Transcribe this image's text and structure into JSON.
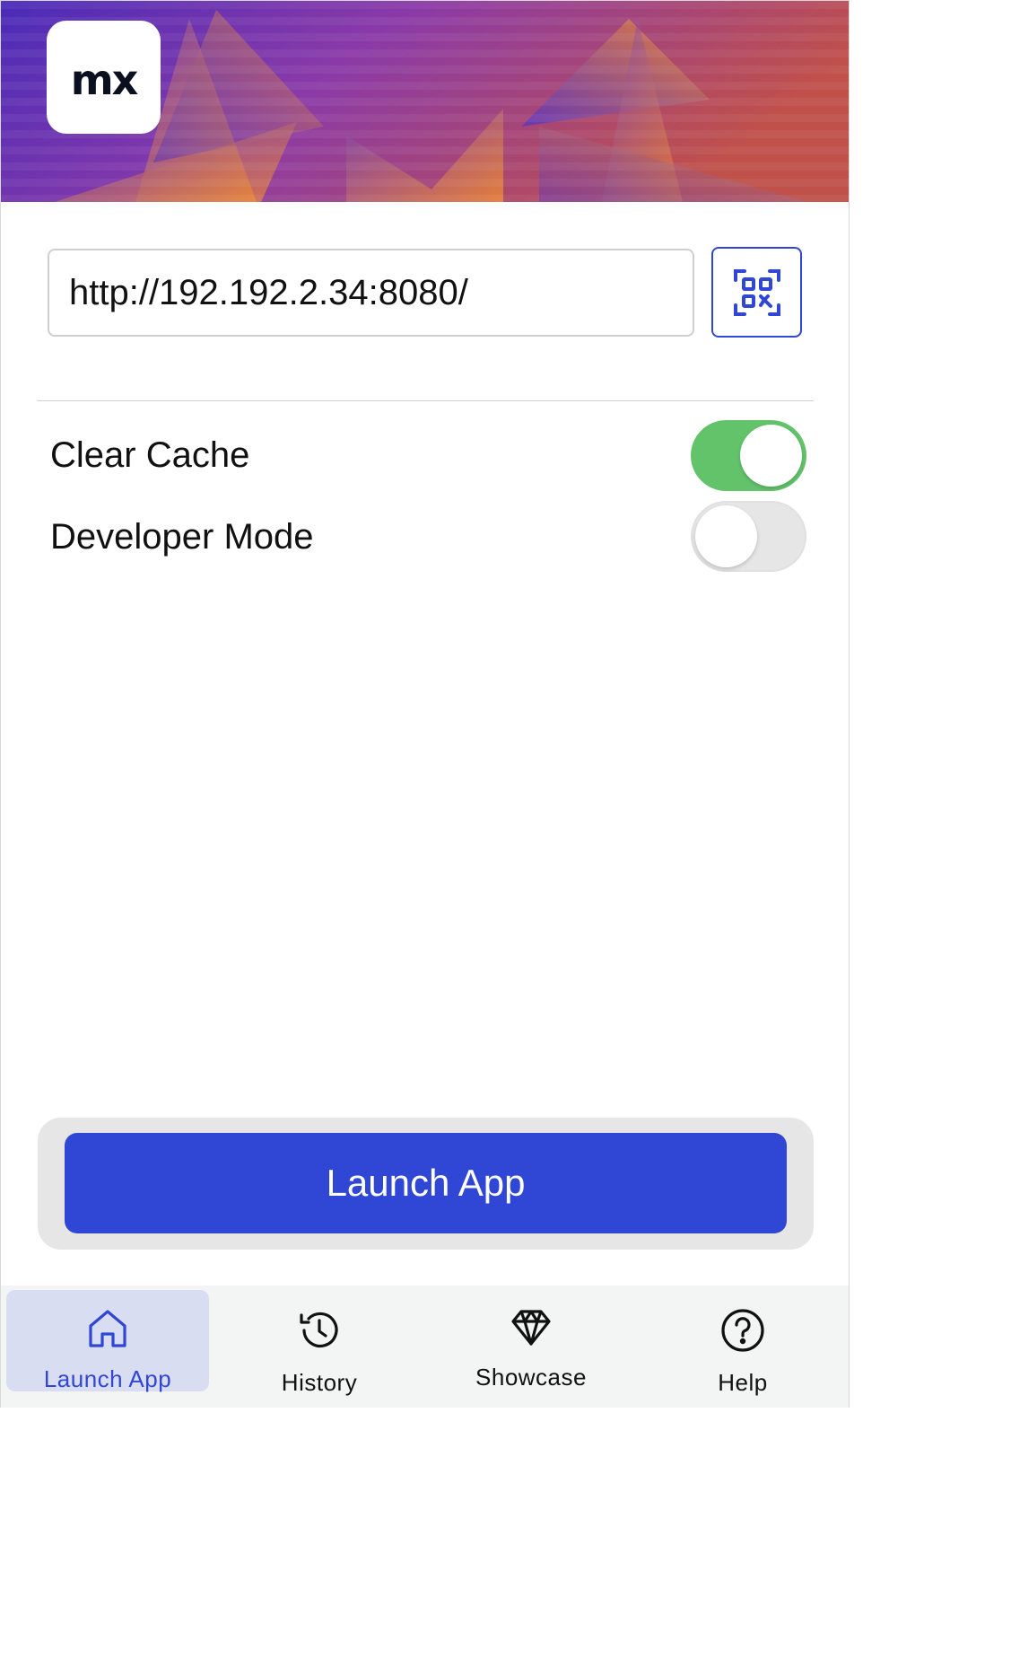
{
  "header": {
    "logo_text": "mx"
  },
  "url_input": {
    "value": "http://192.192.2.34:8080/",
    "scan_icon": "qr-code-icon"
  },
  "settings": {
    "clear_cache": {
      "label": "Clear Cache",
      "enabled": true
    },
    "developer_mode": {
      "label": "Developer Mode",
      "enabled": false
    }
  },
  "launch": {
    "label": "Launch App"
  },
  "tabs": [
    {
      "label": "Launch App",
      "icon": "home-icon",
      "active": true
    },
    {
      "label": "History",
      "icon": "history-icon",
      "active": false
    },
    {
      "label": "Showcase",
      "icon": "diamond-icon",
      "active": false
    },
    {
      "label": "Help",
      "icon": "help-icon",
      "active": false
    }
  ],
  "colors": {
    "accent": "#3047d6",
    "toggle_on": "#63c36b",
    "banner_purple": "#5a2fb8",
    "banner_orange": "#e8803a"
  }
}
